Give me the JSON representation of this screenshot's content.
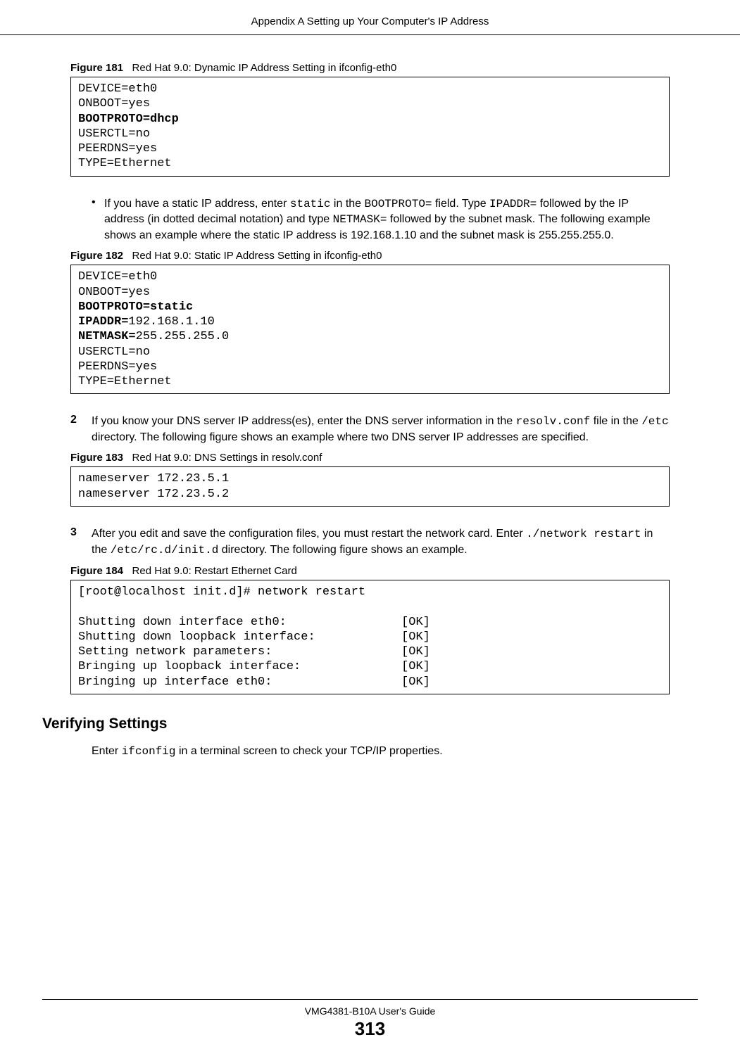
{
  "header": {
    "title": "Appendix A Setting up Your Computer's IP Address"
  },
  "figures": {
    "fig181": {
      "num": "Figure 181",
      "title": "Red Hat 9.0: Dynamic IP Address Setting in ifconfig-eth0",
      "line1": "DEVICE=eth0",
      "line2": "ONBOOT=yes",
      "line3": "BOOTPROTO=dhcp",
      "line4": "USERCTL=no",
      "line5": "PEERDNS=yes",
      "line6": "TYPE=Ethernet"
    },
    "fig182": {
      "num": "Figure 182",
      "title": "Red Hat 9.0: Static IP Address Setting in ifconfig-eth0",
      "line1": "DEVICE=eth0",
      "line2": "ONBOOT=yes",
      "line3a": "BOOTPROTO=static",
      "line4a": "IPADDR=",
      "line4b": "192.168.1.10",
      "line5a": "NETMASK=",
      "line5b": "255.255.255.0",
      "line6": "USERCTL=no",
      "line7": "PEERDNS=yes",
      "line8": "TYPE=Ethernet"
    },
    "fig183": {
      "num": "Figure 183",
      "title": "Red Hat 9.0: DNS Settings in resolv.conf",
      "line1": "nameserver 172.23.5.1",
      "line2": "nameserver 172.23.5.2"
    },
    "fig184": {
      "num": "Figure 184",
      "title": "Red Hat 9.0: Restart Ethernet Card",
      "line1": "[root@localhost init.d]# network restart",
      "blank": "",
      "line2": "Shutting down interface eth0:                [OK]",
      "line3": "Shutting down loopback interface:            [OK]",
      "line4": "Setting network parameters:                  [OK]",
      "line5": "Bringing up loopback interface:              [OK]",
      "line6": "Bringing up interface eth0:                  [OK]"
    }
  },
  "bullet1": {
    "t1": "If you have a static IP address, enter ",
    "c1": "static",
    "t2": " in the ",
    "c2": "BOOTPROTO=",
    "t3": " field. Type ",
    "c3": "IPADDR=",
    "t4": " followed by the IP address (in dotted decimal notation) and type ",
    "c4": "NETMASK=",
    "t5": " followed by the subnet mask. The following example shows an example where the static IP address is 192.168.1.10 and the subnet mask is 255.255.255.0."
  },
  "step2": {
    "num": "2",
    "t1": "If you know your DNS server IP address(es), enter the DNS server information in the ",
    "c1": "resolv.conf",
    "t2": " file in the ",
    "c2": "/etc",
    "t3": " directory.  The following figure shows an example where two DNS server IP addresses are specified."
  },
  "step3": {
    "num": "3",
    "t1": "After you edit and save the configuration files, you must restart the network card. Enter ",
    "c1": "./network restart",
    "t2": " in the ",
    "c2": "/etc/rc.d/init.d",
    "t3": " directory.  The following figure shows an example."
  },
  "verifying": {
    "heading": "Verifying Settings",
    "t1": "Enter ",
    "c1": "ifconfig",
    "t2": " in a terminal screen to check your TCP/IP properties."
  },
  "footer": {
    "guide": "VMG4381-B10A User's Guide",
    "page": "313"
  }
}
